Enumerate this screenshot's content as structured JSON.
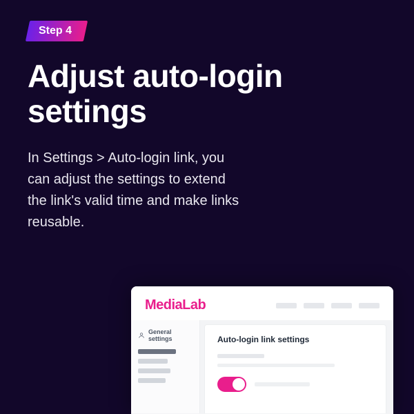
{
  "badge": {
    "label": "Step 4"
  },
  "title": "Adjust auto-login settings",
  "description": "In Settings > Auto-login link, you can adjust the settings to extend the link's valid time and make links reusable.",
  "mockup": {
    "logo": "MediaLab",
    "sidebar": {
      "active_label": "General settings"
    },
    "panel": {
      "title": "Auto-login link settings"
    }
  }
}
